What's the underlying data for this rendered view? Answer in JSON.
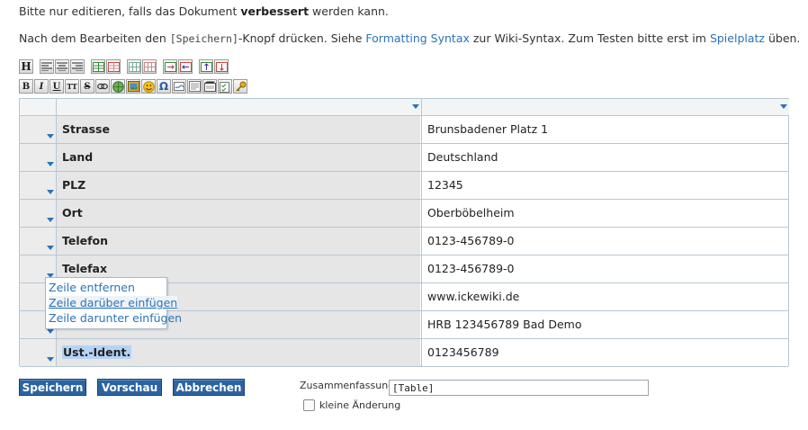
{
  "notice": {
    "before": "Bitte nur editieren, falls das Dokument ",
    "bold": "verbessert",
    "after": " werden kann."
  },
  "help": {
    "t1": "Nach dem Bearbeiten den ",
    "code": "[Speichern]",
    "t2": "-Knopf drücken. Siehe ",
    "link1": "Formatting Syntax",
    "t3": " zur Wiki-Syntax. Zum Testen bitte erst im ",
    "link2": "Spielplatz",
    "t4": " üben."
  },
  "toolbar": {
    "row1": [
      "heading-icon",
      "align-left-icon",
      "align-center-icon",
      "align-right-icon",
      "insert-row-above-icon",
      "delete-row-icon",
      "insert-col-icon",
      "delete-col-icon",
      "merge-cells-icon",
      "move-left-right-icon",
      "move-up-down-icon",
      "split-cells-icon"
    ],
    "row2": [
      "bold-icon",
      "italic-icon",
      "underline-icon",
      "monospace-icon",
      "strikethrough-icon",
      "link-icon",
      "external-link-icon",
      "image-icon",
      "smiley-icon",
      "special-chars-icon",
      "signature-icon",
      "media-icon",
      "code-icon",
      "checklist-icon",
      "key-icon"
    ],
    "labels": {
      "bold": "B",
      "italic": "I",
      "underline": "U",
      "mono": "TT",
      "strike": "S",
      "heading": "H",
      "omega": "Ω"
    }
  },
  "table": {
    "rows": [
      {
        "key": "Strasse",
        "value": "Brunsbadener Platz 1"
      },
      {
        "key": "Land",
        "value": "Deutschland"
      },
      {
        "key": "PLZ",
        "value": "12345"
      },
      {
        "key": "Ort",
        "value": "Oberböbelheim"
      },
      {
        "key": "Telefon",
        "value": "0123-456789-0"
      },
      {
        "key": "Telefax",
        "value": "0123-456789-0"
      },
      {
        "key": "",
        "value": "www.ickewiki.de"
      },
      {
        "key": "",
        "value": "HRB 123456789 Bad Demo"
      },
      {
        "key": "Ust.-Ident.",
        "value": "0123456789"
      }
    ]
  },
  "context_menu": {
    "items": [
      "Zeile entfernen",
      "Zeile darüber einfügen",
      "Zeile darunter einfügen"
    ]
  },
  "actions": {
    "save": "Speichern",
    "preview": "Vorschau",
    "cancel": "Abbrechen"
  },
  "summary": {
    "label": "Zusammenfassung",
    "value": "[Table]"
  },
  "minor": {
    "label": "kleine Änderung"
  },
  "colors": {
    "link": "#2b73b7",
    "button": "#2c64a2",
    "selection": "#b5d3f5"
  }
}
